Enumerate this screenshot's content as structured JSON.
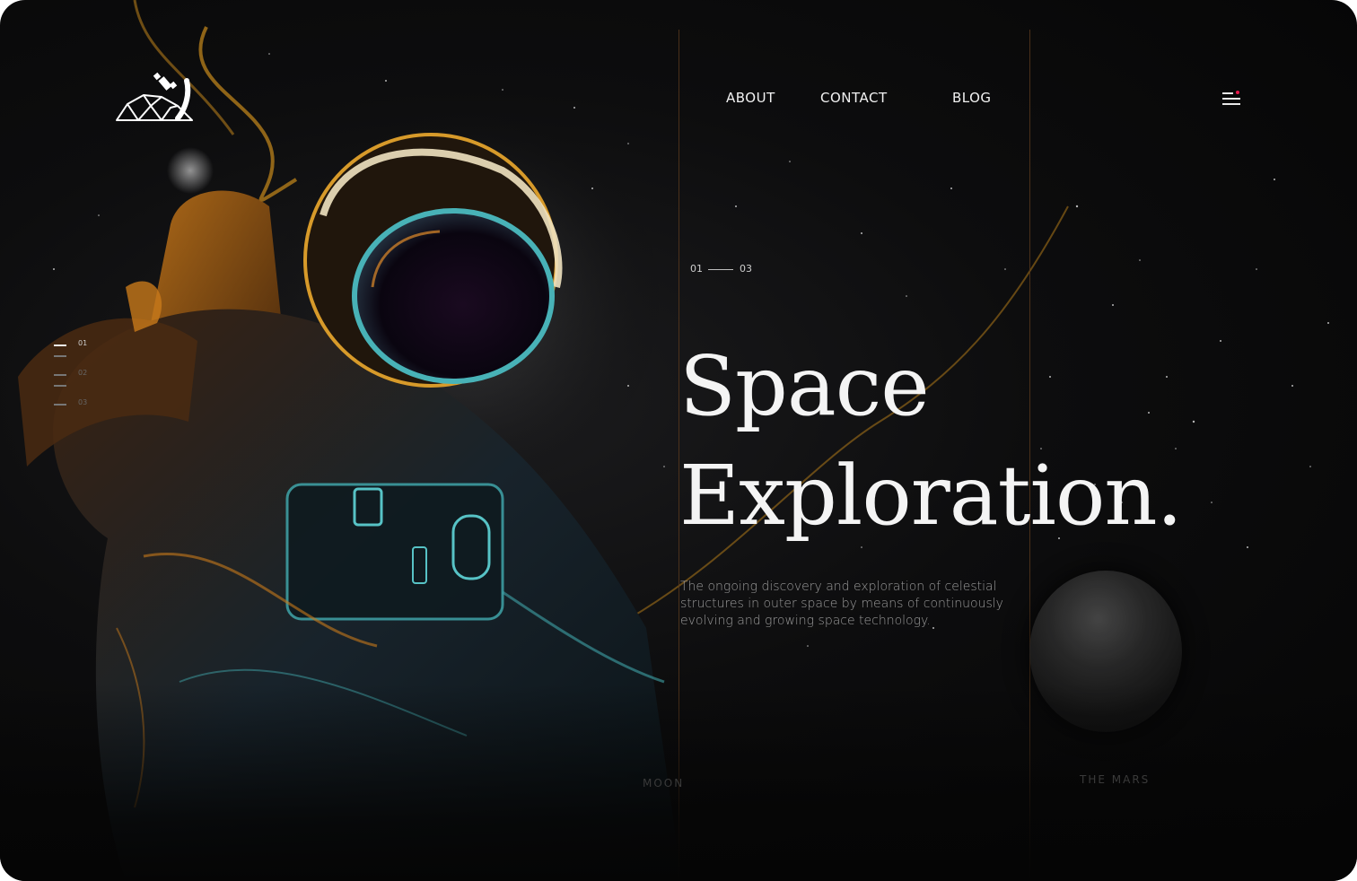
{
  "nav": {
    "about": "ABOUT",
    "contact": "CONTACT",
    "blog": "BLOG"
  },
  "slides": {
    "items": [
      "01",
      "02",
      "03"
    ],
    "active": "01"
  },
  "counter": {
    "current": "01",
    "total": "03"
  },
  "hero": {
    "title_line1": "Space",
    "title_line2": "Exploration.",
    "description": "The ongoing discovery and exploration of celestial structures in outer space by means of continuously evolving and growing space technology."
  },
  "cards": {
    "moon_label": "MOON",
    "mars_label": "THE MARS"
  },
  "colors": {
    "background": "#0b0b0c",
    "accent_line": "#5a3a1e",
    "notification_dot": "#e8174a",
    "text_primary": "#f4f4f4",
    "text_secondary": "#9a9a9a"
  },
  "icons": {
    "logo": "satellite-dome-logo-icon",
    "menu": "hamburger-menu-icon"
  }
}
